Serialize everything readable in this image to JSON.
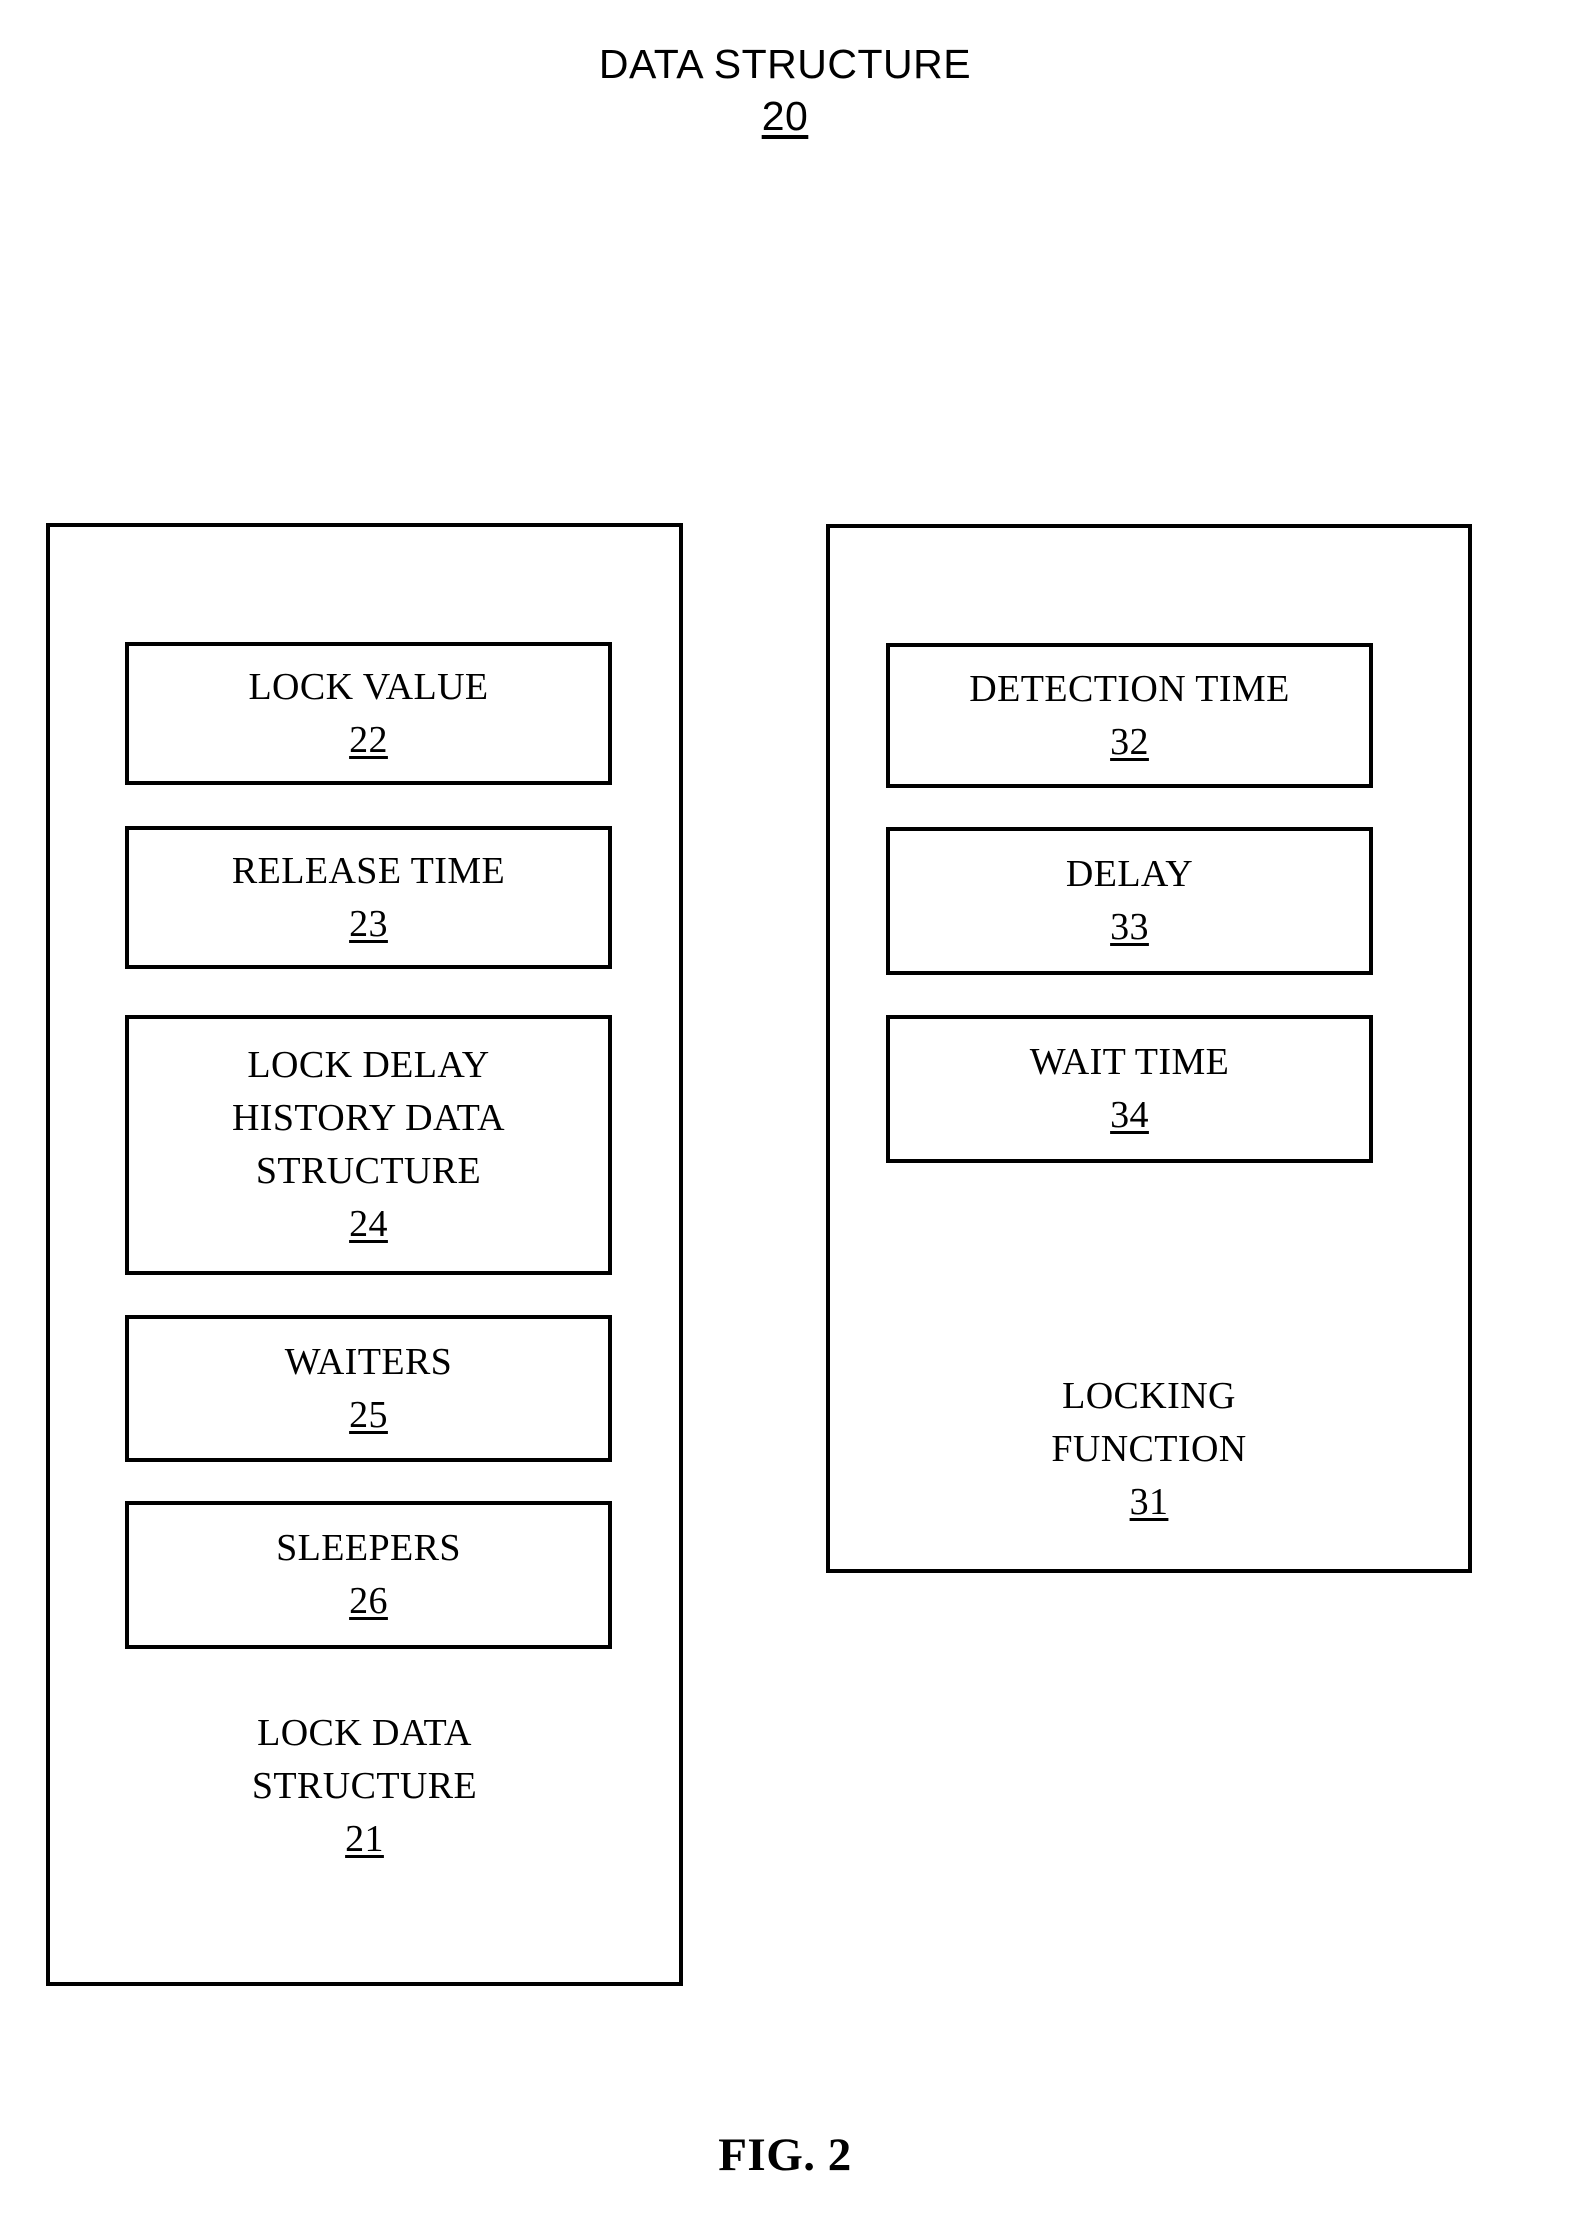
{
  "figure": {
    "title_label": "DATA STRUCTURE",
    "title_ref": "20",
    "figure_number": "FIG. 2"
  },
  "lock_data_structure": {
    "caption_line1": "LOCK DATA",
    "caption_line2": "STRUCTURE",
    "caption_ref": "21",
    "fields": [
      {
        "label": "LOCK VALUE",
        "ref": "22"
      },
      {
        "label": "RELEASE TIME",
        "ref": "23"
      },
      {
        "label_line1": "LOCK DELAY",
        "label_line2": "HISTORY DATA",
        "label_line3": "STRUCTURE",
        "ref": "24"
      },
      {
        "label": "WAITERS",
        "ref": "25"
      },
      {
        "label": "SLEEPERS",
        "ref": "26"
      }
    ]
  },
  "locking_function": {
    "caption_line1": "LOCKING",
    "caption_line2": "FUNCTION",
    "caption_ref": "31",
    "fields": [
      {
        "label": "DETECTION TIME",
        "ref": "32"
      },
      {
        "label": "DELAY",
        "ref": "33"
      },
      {
        "label": "WAIT TIME",
        "ref": "34"
      }
    ]
  },
  "colors": {
    "stroke": "#000000",
    "background": "#ffffff",
    "text": "#000000"
  }
}
